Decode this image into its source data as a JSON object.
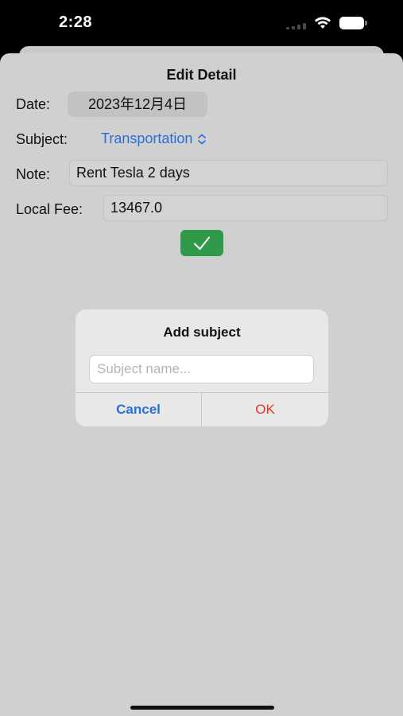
{
  "status_bar": {
    "time": "2:28"
  },
  "sheet": {
    "title": "Edit Detail",
    "date": {
      "label": "Date:",
      "value": "2023年12月4日"
    },
    "subject": {
      "label": "Subject:",
      "value": "Transportation"
    },
    "note": {
      "label": "Note:",
      "value": "Rent Tesla 2 days"
    },
    "local_fee": {
      "label": "Local Fee:",
      "value": "13467.0"
    },
    "confirm_icon": "checkmark-icon"
  },
  "alert": {
    "title": "Add subject",
    "input_placeholder": "Subject name...",
    "input_value": "",
    "cancel_label": "Cancel",
    "ok_label": "OK"
  },
  "colors": {
    "accent_blue": "#2a6fd6",
    "confirm_green": "#2f9a4a",
    "destructive_red": "#e0382e",
    "sheet_bg": "#d0d0d0"
  }
}
